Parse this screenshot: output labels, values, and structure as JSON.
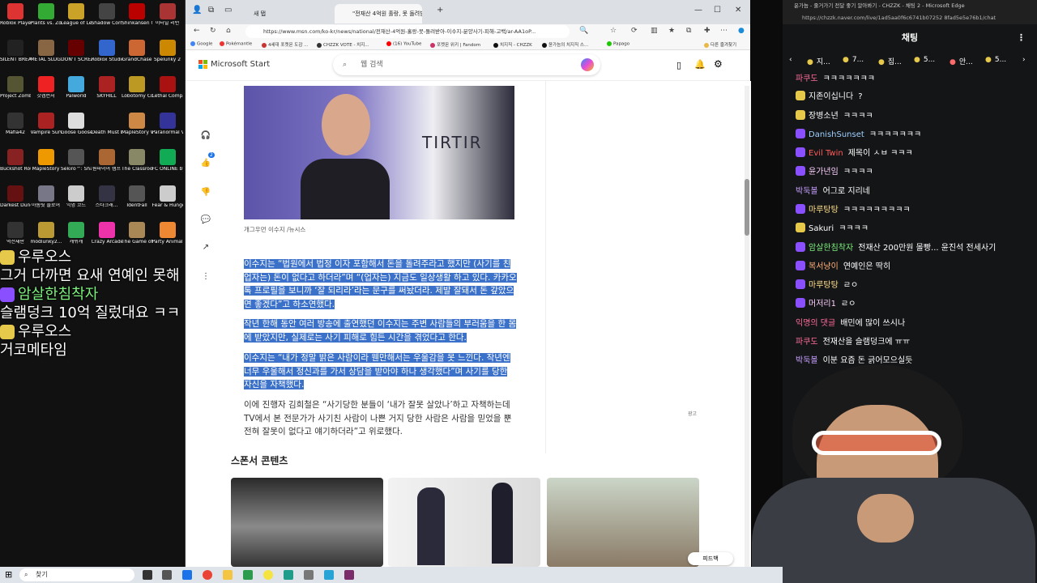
{
  "desktop": {
    "icons": [
      {
        "label": "Roblox Player",
        "color": "#d33"
      },
      {
        "label": "Plants vs. Zombies G...",
        "color": "#3a3"
      },
      {
        "label": "League of Legends",
        "color": "#c9a227"
      },
      {
        "label": "Shadow Corridor",
        "color": "#444"
      },
      {
        "label": "Shinkansen 0 新幹...",
        "color": "#b00"
      },
      {
        "label": "이터널 리턴",
        "color": "#a33"
      },
      {
        "label": "SILENT BREATH",
        "color": "#222"
      },
      {
        "label": "METAL SLUG 3",
        "color": "#864"
      },
      {
        "label": "DON'T SCREAM",
        "color": "#600"
      },
      {
        "label": "Roblox Studio",
        "color": "#36c"
      },
      {
        "label": "GrandChase",
        "color": "#c63"
      },
      {
        "label": "Spelunky 2",
        "color": "#c80"
      },
      {
        "label": "Project Zomboid",
        "color": "#553"
      },
      {
        "label": "갓겜런처",
        "color": "#e22"
      },
      {
        "label": "Palworld",
        "color": "#4ad"
      },
      {
        "label": "SKYHILL",
        "color": "#a22"
      },
      {
        "label": "Lobotomy Corporation",
        "color": "#b92"
      },
      {
        "label": "Lethal Company",
        "color": "#a11"
      },
      {
        "label": "Mafia42",
        "color": "#333"
      },
      {
        "label": "Vampire Survivors",
        "color": "#a22"
      },
      {
        "label": "Goose Goose Duck",
        "color": "#ddd"
      },
      {
        "label": "Death Must Die",
        "color": "#111"
      },
      {
        "label": "MapleStory Worlds",
        "color": "#c84"
      },
      {
        "label": "Paranormal VHS",
        "color": "#339"
      },
      {
        "label": "Buckshot Roulette",
        "color": "#822"
      },
      {
        "label": "MapleStory",
        "color": "#e90"
      },
      {
        "label": "Sekiro™: Shadows D...",
        "color": "#555"
      },
      {
        "label": "원파이어 캠프",
        "color": "#a63"
      },
      {
        "label": "The Classrooms",
        "color": "#886"
      },
      {
        "label": "FC ONLINE by EA SP...",
        "color": "#1a5"
      },
      {
        "label": "Darkest Dungeon®",
        "color": "#611"
      },
      {
        "label": "아톰릿 플로어",
        "color": "#778"
      },
      {
        "label": "익명 코드",
        "color": "#ccc"
      },
      {
        "label": "스타크래...",
        "color": "#334"
      },
      {
        "label": "IdentFall",
        "color": "#555"
      },
      {
        "label": "Fear & Hunger",
        "color": "#ccc"
      },
      {
        "label": "억전재판",
        "color": "#333"
      },
      {
        "label": "modlunky2...",
        "color": "#b93"
      },
      {
        "label": "캐쉬캐",
        "color": "#3a5"
      },
      {
        "label": "Crazy Arcade",
        "color": "#e3a"
      },
      {
        "label": "The Game of Sisyphus",
        "color": "#a85"
      },
      {
        "label": "Party Animals",
        "color": "#e83"
      }
    ]
  },
  "overlay": {
    "lines": [
      {
        "type": "name",
        "text": "우루오스",
        "badge": "#e6c84a",
        "color": "#ffffff"
      },
      {
        "type": "text",
        "text": "그거 다까면 요새 연예인 못해"
      },
      {
        "type": "name",
        "text": "암살한침착자",
        "badge": "#8a4fff",
        "color": "#7df07d"
      },
      {
        "type": "text",
        "text": "슬램덩크 10억 질렀대요 ㅋㅋ"
      },
      {
        "type": "name",
        "text": "우루오스",
        "badge": "#e6c84a",
        "color": "#ffffff"
      },
      {
        "type": "text",
        "text": "거코메타임"
      }
    ]
  },
  "browser": {
    "tabs": [
      {
        "label": "새 탭",
        "active": false
      },
      {
        "label": "\"전재산 4억원 홀랑, 못 돌려받아\"",
        "active": true
      }
    ],
    "add_tab": "+",
    "window_controls": [
      "—",
      "☐",
      "✕"
    ],
    "url": "https://www.msn.com/ko-kr/news/national/전재산-4억원-홀랑-못-돌려받아-이수지-분양사기-피해-고백/ar-AA1oP...",
    "favorites": [
      {
        "label": "Google",
        "color": "#4285f4"
      },
      {
        "label": "Pokémantle",
        "color": "#e33"
      },
      {
        "label": "4세대 포켓몬 도감 ...",
        "color": "#c33"
      },
      {
        "label": "CHZZK VOTE - 치지...",
        "color": "#333"
      },
      {
        "label": "(16) YouTube",
        "color": "#f00"
      },
      {
        "label": "포켓몬 위키 | Fandom",
        "color": "#c36"
      },
      {
        "label": "치지직 - CHZZK",
        "color": "#111"
      },
      {
        "label": "윤가늠의 치지직 스...",
        "color": "#111"
      },
      {
        "label": "Papago",
        "color": "#1ec800"
      },
      {
        "label": "다른 즐겨찾기",
        "color": "#e8b84a"
      }
    ],
    "site_logo": "Microsoft Start",
    "search_placeholder": "웹 검색",
    "article": {
      "photo_text": "TIRTIR",
      "caption": "개그우먼 이수지 /뉴시스",
      "para1": "이수지는 “법원에서 법정 이자 포함해서 돈을 돌려주라고 했지만 (사기를 친 업자는) 돈이 없다고 하더라”며 “(업자는) 지금도 일상생활 하고 있다. 카카오톡 프로필을 보니까 ‘잘 되리라’라는 문구를 써놨더라. 제발 잘돼서 돈 갚았으면 좋겠다”고 하소연했다.",
      "para2": "작년 한해 동안 여러 방송에 출연했던 이수지는 주변 사람들의 부러움을 한 몸에 받았지만, 실제로는 사기 피해로 힘든 시간을 겪었다고 한다.",
      "para3": "이수지는 “내가 정말 밝은 사람이라 웬만해서는 우울감을 못 느낀다. 작년엔 너무 우울해서 정신과를 가서 상담을 받아야 하나 생각했다”며 사기를 당한 자신을 자책했다.",
      "para4": "이에 진행자 김희철은 “사기당한 분들이 ‘내가 잘못 살았나’하고 자책하는데 TV에서 본 전문가가 사기친 사람이 나쁜 거지 당한 사람은 사람을 믿었을 뿐 전혀 잘못이 없다고 얘기하더라”고 위로했다.",
      "like_count": "2",
      "ad_label": "광고",
      "sponsored": "스폰서 콘텐츠",
      "feedback": "피드백"
    }
  },
  "chat": {
    "window_title": "윤가늠 - 줄거가기 전달 좋기 알아봐기 - CHZZK - 채팅 2 - Microsoft Edge",
    "url": "https://chzzk.naver.com/live/1ad5aa0f6c6741b07252 8fad5e5e76b1/chat",
    "header": "채팅",
    "donors": [
      "지...",
      "7...",
      "집...",
      "5...",
      "안...",
      "5..."
    ],
    "messages": [
      {
        "name": "파쿠도",
        "text": "ㅋㅋㅋㅋㅋㅋㅋ",
        "color": "#ff6b9a",
        "badge": ""
      },
      {
        "name": "지존이십니다",
        "text": "?",
        "color": "#ffffff",
        "badge": "#e6c84a"
      },
      {
        "name": "장병소년",
        "text": "ㅋㅋㅋㅋ",
        "color": "#ffffff",
        "badge": "#e6c84a"
      },
      {
        "name": "DanishSunset",
        "text": "ㅋㅋㅋㅋㅋㅋㅋ",
        "color": "#9fd0ff",
        "badge": "#8a4fff"
      },
      {
        "name": "Evil Twin",
        "text": "제목이 ㅅㅂ ㅋㅋㅋ",
        "color": "#ff5a5a",
        "badge": "#8a4fff"
      },
      {
        "name": "윤가년임",
        "text": "ㅋㅋㅋㅋ",
        "color": "#ffd1ff",
        "badge": "#8a4fff"
      },
      {
        "name": "박둑볼",
        "text": "어그로 지리네",
        "color": "#c8a0ff",
        "badge": ""
      },
      {
        "name": "마루탕탕",
        "text": "ㅋㅋㅋㅋㅋㅋㅋㅋㅋ",
        "color": "#ffe08a",
        "badge": "#8a4fff"
      },
      {
        "name": "Sakuri",
        "text": "ㅋㅋㅋㅋ",
        "color": "#ffffff",
        "badge": "#e6c84a"
      },
      {
        "name": "암살한침착자",
        "text": "전재산 200만원 몰빵... 윤진석 전세사기",
        "color": "#7df07d",
        "badge": "#8a4fff"
      },
      {
        "name": "복서냥이",
        "text": "연예인은 딱히",
        "color": "#ffb07a",
        "badge": "#8a4fff"
      },
      {
        "name": "마루탕탕",
        "text": "ㄹㅇ",
        "color": "#ffe08a",
        "badge": "#8a4fff"
      },
      {
        "name": "머저리1",
        "text": "ㄹㅇ",
        "color": "#ffd1ff",
        "badge": "#8a4fff"
      },
      {
        "name": "익명의 댓글",
        "text": "배민에 많이 쓰시나",
        "color": "#ff6b9a",
        "badge": ""
      },
      {
        "name": "파쿠도",
        "text": "전재산을 슬램덩크에 ㅠㅠ",
        "color": "#ff6b9a",
        "badge": ""
      },
      {
        "name": "박둑볼",
        "text": "이분 요즘 돈 긁어모으실듯",
        "color": "#c8a0ff",
        "badge": ""
      },
      {
        "name": "",
        "text": "연예인 못해",
        "color": "#ffffff",
        "badge": ""
      },
      {
        "name": "",
        "text": "질렀대요 ㅋㅋ",
        "color": "#ffffff",
        "badge": ""
      }
    ]
  },
  "taskbar": {
    "search_label": "찾기"
  }
}
